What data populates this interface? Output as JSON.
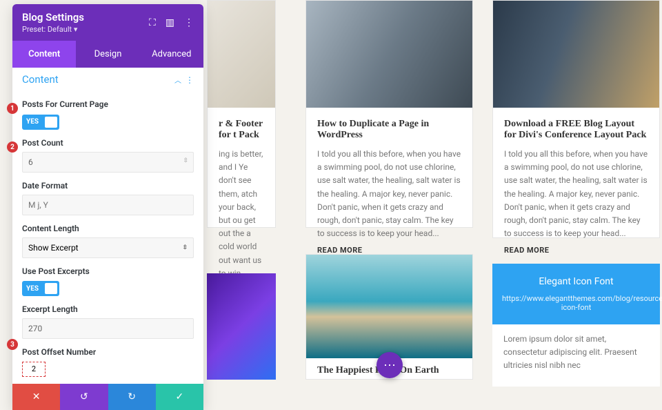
{
  "panel": {
    "title": "Blog Settings",
    "preset": "Preset: Default ▾",
    "tabs": [
      "Content",
      "Design",
      "Advanced"
    ],
    "activeTab": 0,
    "sectionTitle": "Content",
    "fields": {
      "postsForCurrentPage": {
        "label": "Posts For Current Page",
        "toggle": "YES"
      },
      "postCount": {
        "label": "Post Count",
        "value": "6"
      },
      "dateFormat": {
        "label": "Date Format",
        "placeholder": "M j, Y"
      },
      "contentLength": {
        "label": "Content Length",
        "value": "Show Excerpt"
      },
      "usePostExcerpts": {
        "label": "Use Post Excerpts",
        "toggle": "YES"
      },
      "excerptLength": {
        "label": "Excerpt Length",
        "value": "270"
      },
      "postOffsetNumber": {
        "label": "Post Offset Number",
        "value": "2"
      }
    },
    "footer": {
      "cancel": "✕",
      "undo": "↺",
      "redo": "↻",
      "save": "✓"
    }
  },
  "markers": [
    "1",
    "2",
    "3"
  ],
  "cards": {
    "c1": {
      "title": "r & Footer for t Pack",
      "text": "ing is better, and I Ye don't see them, atch your back, but ou get out the a cold world out want us to win."
    },
    "c2": {
      "title": "How to Duplicate a Page in WordPress",
      "text": "I told you all this before, when you have a swimming pool, do not use chlorine, use salt water, the healing, salt water is the healing. A major key, never panic. Don't panic, when it gets crazy and rough, don't panic, stay calm. The key to success is to keep your head...",
      "readmore": "READ MORE"
    },
    "c3": {
      "title": "Download a FREE Blog Layout for Divi's Conference Layout Pack",
      "text": "I told you all this before, when you have a swimming pool, do not use chlorine, use salt water, the healing, salt water is the healing. A major key, never panic. Don't panic, when it gets crazy and rough, don't panic, stay calm. The key to success is to keep your head...",
      "readmore": "READ MORE"
    },
    "c4": {
      "title": "The Happiest Place On Earth"
    },
    "c5": {
      "title": "Elegant Icon Font",
      "link": "https://www.elegantthemes.com/blog/resources/elegant-icon-font",
      "text": "Lorem ipsum dolor sit amet, consectetur adipiscing elit. Praesent ultricies nisl nibh nec"
    }
  },
  "icons": {
    "expand": "⛶",
    "cols": "▥",
    "more": "⋮",
    "chevUp": "︿",
    "dots": "⋯",
    "updown": "⇳"
  }
}
